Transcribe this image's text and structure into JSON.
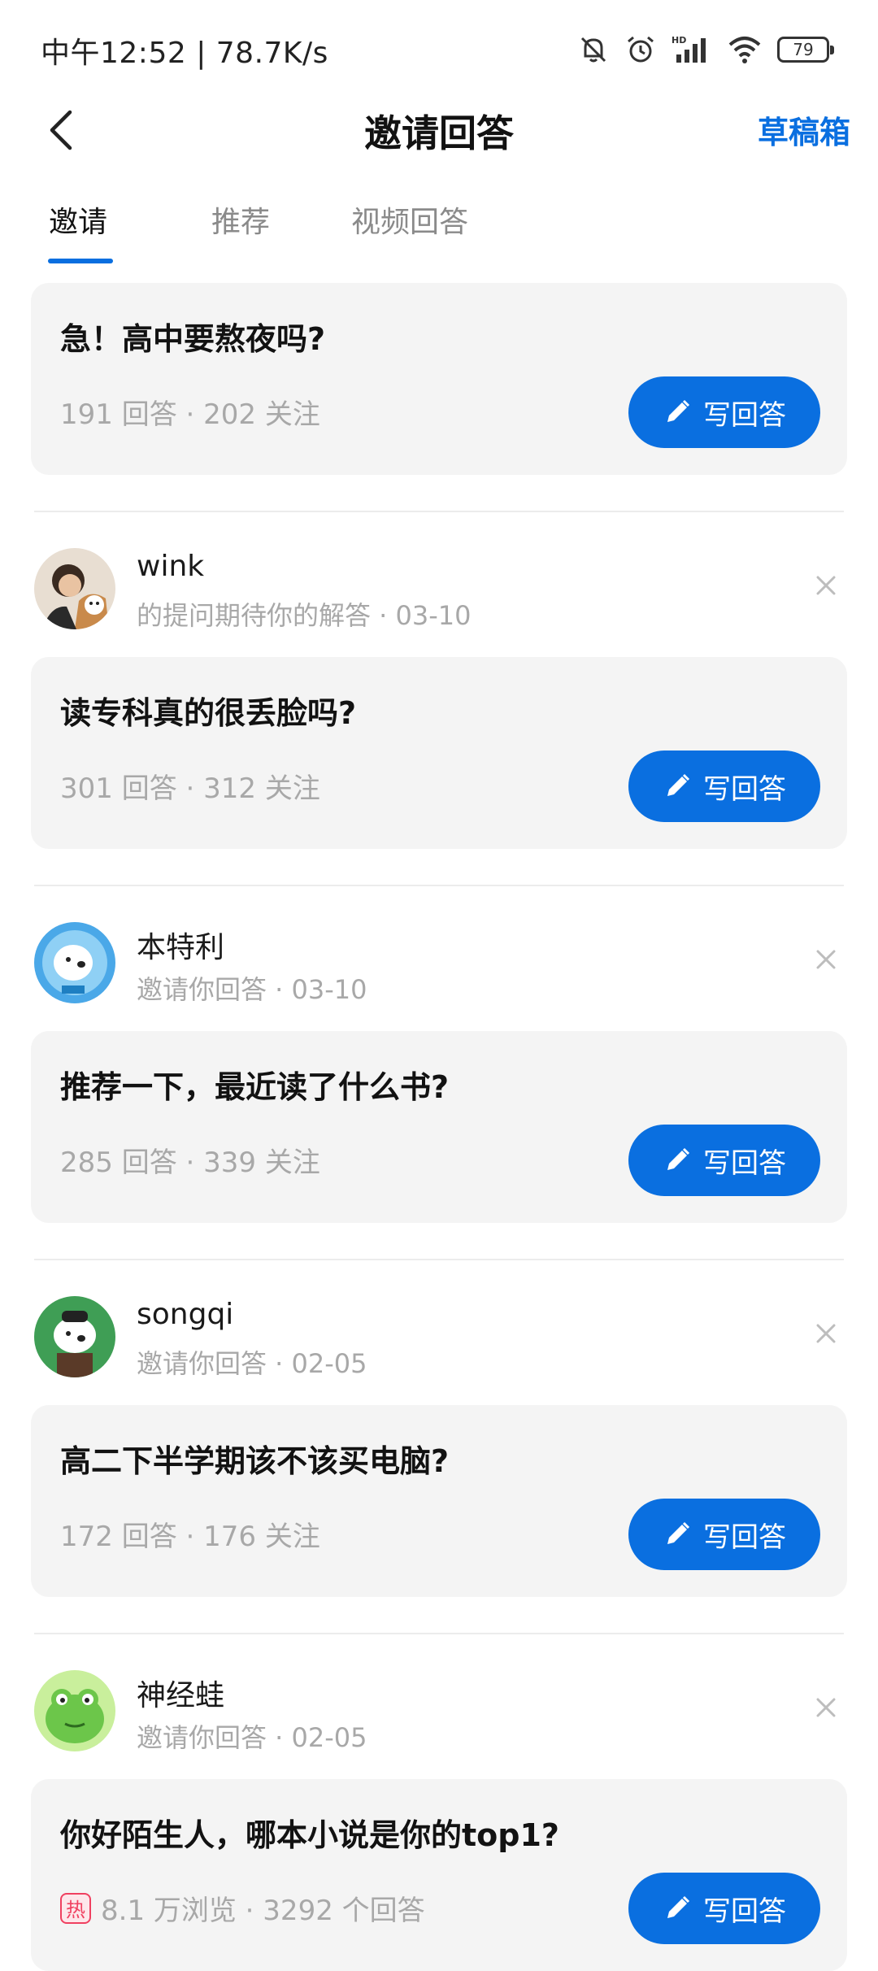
{
  "status": {
    "time_speed": "中午12:52 | 78.7K/s",
    "battery": "79"
  },
  "header": {
    "title": "邀请回答",
    "drafts": "草稿箱"
  },
  "tabs": [
    "邀请",
    "推荐",
    "视频回答"
  ],
  "write_label": "写回答",
  "top_card": {
    "title": "急！高中要熬夜吗?",
    "meta": "191 回答 · 202 关注"
  },
  "invites": [
    {
      "name": "wink",
      "subtitle": "的提问期待你的解答 · 03-10",
      "title": "读专科真的很丢脸吗?",
      "meta": "301 回答 · 312 关注"
    },
    {
      "name": "本特利",
      "subtitle": "邀请你回答 · 03-10",
      "title": "推荐一下，最近读了什么书?",
      "meta": "285 回答 · 339 关注"
    },
    {
      "name": "songqi",
      "subtitle": "邀请你回答 · 02-05",
      "title": "高二下半学期该不该买电脑?",
      "meta": "172 回答 · 176 关注"
    },
    {
      "name": "神经蛙",
      "subtitle": "邀请你回答 · 02-05",
      "title": "你好陌生人，哪本小说是你的top1?",
      "hot_badge": "热",
      "meta": "8.1 万浏览 · 3292 个回答"
    }
  ],
  "colors": {
    "accent": "#0a6fe0",
    "card_bg": "#f4f4f4",
    "meta_text": "#a8a8a8"
  }
}
